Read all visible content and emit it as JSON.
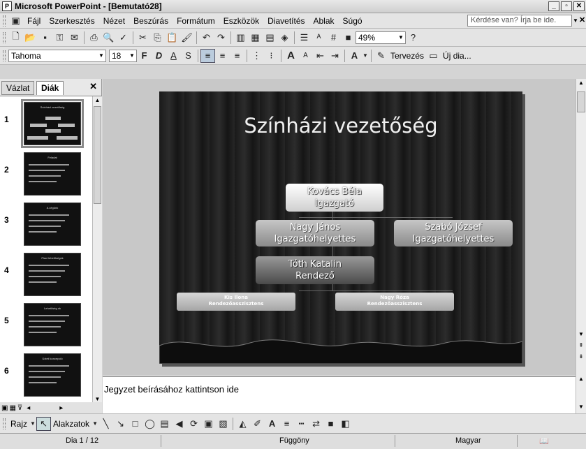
{
  "window": {
    "title": "Microsoft PowerPoint - [Bemutató28]"
  },
  "menu": {
    "items": [
      "Fájl",
      "Szerkesztés",
      "Nézet",
      "Beszúrás",
      "Formátum",
      "Eszközök",
      "Diavetítés",
      "Ablak",
      "Súgó"
    ],
    "help_placeholder": "Kérdése van? Írja be ide."
  },
  "standard_toolbar": {
    "zoom": "49%"
  },
  "format_toolbar": {
    "font": "Tahoma",
    "size": "18",
    "bold": "F",
    "italic": "D",
    "underline": "A",
    "shadow": "S",
    "design_label": "Tervezés",
    "new_slide_label": "Új dia..."
  },
  "left_pane": {
    "tabs": [
      "Vázlat",
      "Diák"
    ],
    "active_tab": "Diák",
    "slides": [
      {
        "num": "1",
        "title": "Színházi vezetőség"
      },
      {
        "num": "2",
        "title": "Feladat"
      },
      {
        "num": "3",
        "title": "A cégünk"
      },
      {
        "num": "4",
        "title": "Piaci lehetőségek"
      },
      {
        "num": "5",
        "title": "Lehetőség ok"
      },
      {
        "num": "6",
        "title": "Üzleti koncepció"
      }
    ]
  },
  "slide": {
    "title": "Színházi vezetőség",
    "org": {
      "top": {
        "name": "Kovács Béla",
        "role": "Igazgató"
      },
      "deputy_left": {
        "name": "Nagy János",
        "role": "Igazgatóhelyettes"
      },
      "deputy_right": {
        "name": "Szabó József",
        "role": "Igazgatóhelyettes"
      },
      "director": {
        "name": "Tóth Katalin",
        "role": "Rendező"
      },
      "assistant_left": {
        "name": "Kis Ilona",
        "role": "Rendezőasszisztens"
      },
      "assistant_right": {
        "name": "Nagy Róza",
        "role": "Rendezőasszisztens"
      }
    }
  },
  "notes": {
    "placeholder": "Jegyzet beírásához kattintson ide"
  },
  "drawing_toolbar": {
    "draw_label": "Rajz",
    "autoshapes_label": "Alakzatok"
  },
  "status": {
    "slide": "Dia 1 / 12",
    "design": "Függöny",
    "language": "Magyar"
  }
}
